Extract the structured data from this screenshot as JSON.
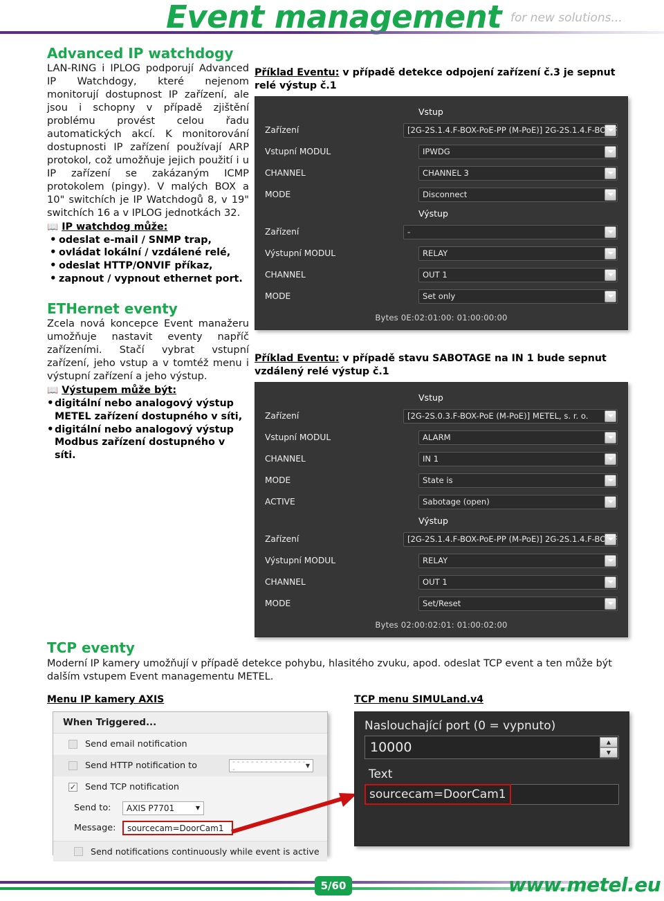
{
  "header": {
    "title": "Event management",
    "tagline": "for new solutions..."
  },
  "left_column": {
    "section1": {
      "heading": "Advanced IP watchdogy",
      "paragraph": "LAN-RING i IPLOG podporují Advanced IP Watchdogy, které nejenom monitorují dostupnost IP zařízení, ale jsou i schopny v případě zjištění problému provést celou řadu automatických akcí. K monitorování dostupnosti IP zařízení používají ARP protokol, což umožňuje jejich použití i u IP zařízení se zakázaným ICMP protokolem (pingy). V malých BOX a 10\" switchích je IP Watchdogů 8, v 19\" switchích 16 a v IPLOG jednotkách 32.",
      "book_label": "IP watchdog může:",
      "bullets": [
        "odeslat e-mail / SNMP trap,",
        "ovládat lokální / vzdálené relé,",
        "odeslat HTTP/ONVIF příkaz,",
        "zapnout / vypnout ethernet port."
      ]
    },
    "section2": {
      "heading": "ETHernet eventy",
      "paragraph": "Zcela nová koncepce Event manažeru umožňuje nastavit eventy napříč zařízeními. Stačí vybrat vstupní zařízení, jeho vstup a v tomtéž menu i výstupní zařízení a jeho výstup.",
      "book_label": "Výstupem může být:",
      "bullets": [
        "digitální nebo analogový výstup METEL zařízení dostupného v síti,",
        "digitální nebo analogový výstup Modbus zařízení dostupného v síti."
      ]
    }
  },
  "panel1": {
    "caption_underlined": "Příklad Eventu:",
    "caption_rest": " v případě detekce odpojení zařízení č.3 je sepnut relé výstup č.1",
    "input_group": "Vstup",
    "output_group": "Výstup",
    "rows_in": [
      {
        "label": "Zařízení",
        "value": "[2G-2S.1.4.F-BOX-PoE-PP (M-PoE)] 2G-2S.1.4.F-BOX-P‹"
      },
      {
        "label": "Vstupní MODUL",
        "value": "IPWDG"
      },
      {
        "label": "CHANNEL",
        "value": "CHANNEL 3"
      },
      {
        "label": "MODE",
        "value": "Disconnect"
      }
    ],
    "rows_out": [
      {
        "label": "Zařízení",
        "value": "-"
      },
      {
        "label": "Výstupní MODUL",
        "value": "RELAY"
      },
      {
        "label": "CHANNEL",
        "value": "OUT 1"
      },
      {
        "label": "MODE",
        "value": "Set only"
      }
    ],
    "bytes": "Bytes 0E:02:01:00: 01:00:00:00"
  },
  "panel2": {
    "caption_underlined": "Příklad Eventu:",
    "caption_rest": " v případě stavu SABOTAGE na IN 1 bude sepnut vzdálený relé výstup č.1",
    "input_group": "Vstup",
    "output_group": "Výstup",
    "rows_in": [
      {
        "label": "Zařízení",
        "value": "[2G-2S.0.3.F-BOX-PoE (M-PoE)] METEL, s. r. o."
      },
      {
        "label": "Vstupní MODUL",
        "value": "ALARM"
      },
      {
        "label": "CHANNEL",
        "value": "IN 1"
      },
      {
        "label": "MODE",
        "value": "State is"
      },
      {
        "label": "ACTIVE",
        "value": "Sabotage (open)"
      }
    ],
    "rows_out": [
      {
        "label": "Zařízení",
        "value": "[2G-2S.1.4.F-BOX-PoE-PP (M-PoE)] 2G-2S.1.4.F-BOX-P‹"
      },
      {
        "label": "Výstupní MODUL",
        "value": "RELAY"
      },
      {
        "label": "CHANNEL",
        "value": "OUT 1"
      },
      {
        "label": "MODE",
        "value": "Set/Reset"
      }
    ],
    "bytes": "Bytes 02:00:02:01: 01:00:02:00"
  },
  "tcp": {
    "heading": "TCP eventy",
    "paragraph": "Moderní IP kamery umožňují v případě detekce pohybu, hlasitého zvuku, apod. odeslat TCP event a ten může být dalším vstupem Event managementu METEL.",
    "label_left": "Menu IP kamery AXIS",
    "label_right": "TCP menu SIMULand.v4"
  },
  "axis_panel": {
    "title": "When Triggered...",
    "opt_email": "Send email notification",
    "opt_http": "Send HTTP notification to",
    "http_placeholder": "- - - - - - - - - - - - - - - - -",
    "opt_tcp": "Send TCP notification",
    "send_to_label": "Send to:",
    "send_to_value": "AXIS P7701",
    "message_label": "Message:",
    "message_value": "sourcecam=DoorCam1",
    "opt_continuous": "Send notifications continuously while event is active",
    "checked": {
      "email": false,
      "http": false,
      "tcp": true,
      "continuous": false
    }
  },
  "simuland_panel": {
    "port_label": "Naslouchající port (0 = vypnuto)",
    "port_value": "10000",
    "text_label": "Text",
    "text_value": "sourcecam=DoorCam1"
  },
  "footer": {
    "page": "5/60",
    "site": "www.metel.eu"
  },
  "colors": {
    "brand_green": "#16a24c",
    "brand_purple": "#5b2d8e",
    "highlight_red": "#cc1111",
    "dialog_dark": "#363636"
  }
}
